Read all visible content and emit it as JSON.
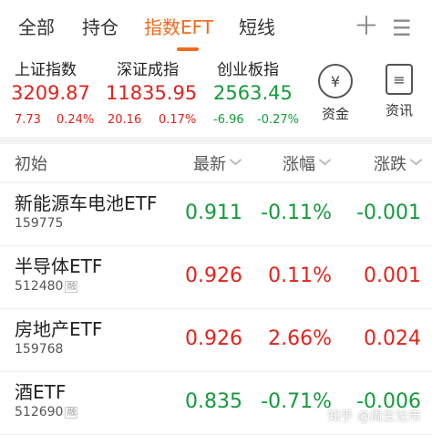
{
  "tabs": [
    {
      "label": "全部"
    },
    {
      "label": "持仓"
    },
    {
      "label": "指数EFT"
    },
    {
      "label": "短线"
    }
  ],
  "top_icons": {
    "add": "plus-icon",
    "menu": "menu-icon"
  },
  "indices": [
    {
      "name": "上证指数",
      "value": "3209.87",
      "change": "7.73",
      "pct": "0.24%",
      "dir": "up"
    },
    {
      "name": "深证成指",
      "value": "11835.95",
      "change": "20.16",
      "pct": "0.17%",
      "dir": "up"
    },
    {
      "name": "创业板指",
      "value": "2563.45",
      "change": "-6.96",
      "pct": "-0.27%",
      "dir": "down"
    }
  ],
  "quick": [
    {
      "label": "资金",
      "icon": "yen-icon",
      "glyph": "¥"
    },
    {
      "label": "资讯",
      "icon": "document-icon",
      "glyph": "≡"
    }
  ],
  "table": {
    "headers": {
      "name": "初始",
      "latest": "最新",
      "pct": "涨幅",
      "chg": "涨跌"
    },
    "rows": [
      {
        "name": "新能源车电池ETF",
        "code": "159775",
        "badge": "",
        "latest": "0.911",
        "pct": "-0.11%",
        "chg": "-0.001",
        "dir": "down"
      },
      {
        "name": "半导体ETF",
        "code": "512480",
        "badge": "融",
        "latest": "0.926",
        "pct": "0.11%",
        "chg": "0.001",
        "dir": "up"
      },
      {
        "name": "房地产ETF",
        "code": "159768",
        "badge": "",
        "latest": "0.926",
        "pct": "2.66%",
        "chg": "0.024",
        "dir": "up"
      },
      {
        "name": "酒ETF",
        "code": "512690",
        "badge": "融",
        "latest": "0.835",
        "pct": "-0.71%",
        "chg": "-0.006",
        "dir": "down"
      }
    ]
  },
  "watermark": "知乎 @周生论市",
  "colors": {
    "accent": "#f26a1b",
    "up": "#e0231c",
    "down": "#139b3b"
  }
}
